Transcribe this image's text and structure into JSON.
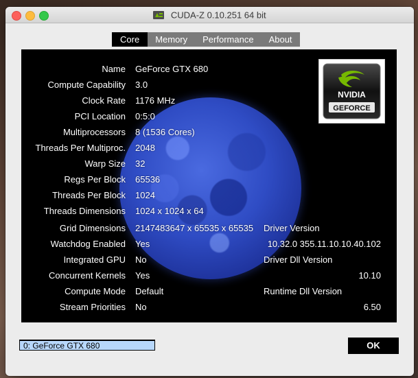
{
  "window": {
    "title": "CUDA-Z 0.10.251 64 bit",
    "app_icon": "cuda-z-app-icon"
  },
  "tabs": [
    {
      "label": "Core",
      "active": true
    },
    {
      "label": "Memory",
      "active": false
    },
    {
      "label": "Performance",
      "active": false
    },
    {
      "label": "About",
      "active": false
    }
  ],
  "core": {
    "rows": [
      {
        "label": "Name",
        "value": "GeForce GTX 680"
      },
      {
        "label": "Compute Capability",
        "value": "3.0"
      },
      {
        "label": "Clock Rate",
        "value": "1176 MHz"
      },
      {
        "label": "PCI Location",
        "value": "0:5:0"
      },
      {
        "label": "Multiprocessors",
        "value": "8 (1536 Cores)"
      },
      {
        "label": "Threads Per Multiproc.",
        "value": "2048"
      },
      {
        "label": "Warp Size",
        "value": "32"
      },
      {
        "label": "Regs Per Block",
        "value": "65536"
      },
      {
        "label": "Threads Per Block",
        "value": "1024"
      },
      {
        "label": "Threads Dimensions",
        "value": "1024 x 1024 x 64"
      },
      {
        "label": "Grid Dimensions",
        "value": "2147483647 x 65535 x 65535"
      },
      {
        "label": "Watchdog Enabled",
        "value": "Yes"
      },
      {
        "label": "Integrated GPU",
        "value": "No"
      },
      {
        "label": "Concurrent Kernels",
        "value": "Yes"
      },
      {
        "label": "Compute Mode",
        "value": "Default"
      },
      {
        "label": "Stream Priorities",
        "value": "No"
      }
    ],
    "driver_version_label": "Driver Version",
    "driver_version_value": "10.32.0 355.11.10.10.40.102",
    "driver_dll_label": "Driver Dll Version",
    "driver_dll_value": "10.10",
    "runtime_dll_label": "Runtime Dll Version",
    "runtime_dll_value": "6.50",
    "logo_text_top": "NVIDIA",
    "logo_text_bottom": "GEFORCE",
    "background_image": "blue-moon-image"
  },
  "footer": {
    "device_select_value": "0: GeForce GTX 680",
    "ok_label": "OK"
  },
  "colors": {
    "panel_bg": "#000000",
    "select_bg": "#b7d7fb",
    "nvidia_green": "#76b900"
  }
}
